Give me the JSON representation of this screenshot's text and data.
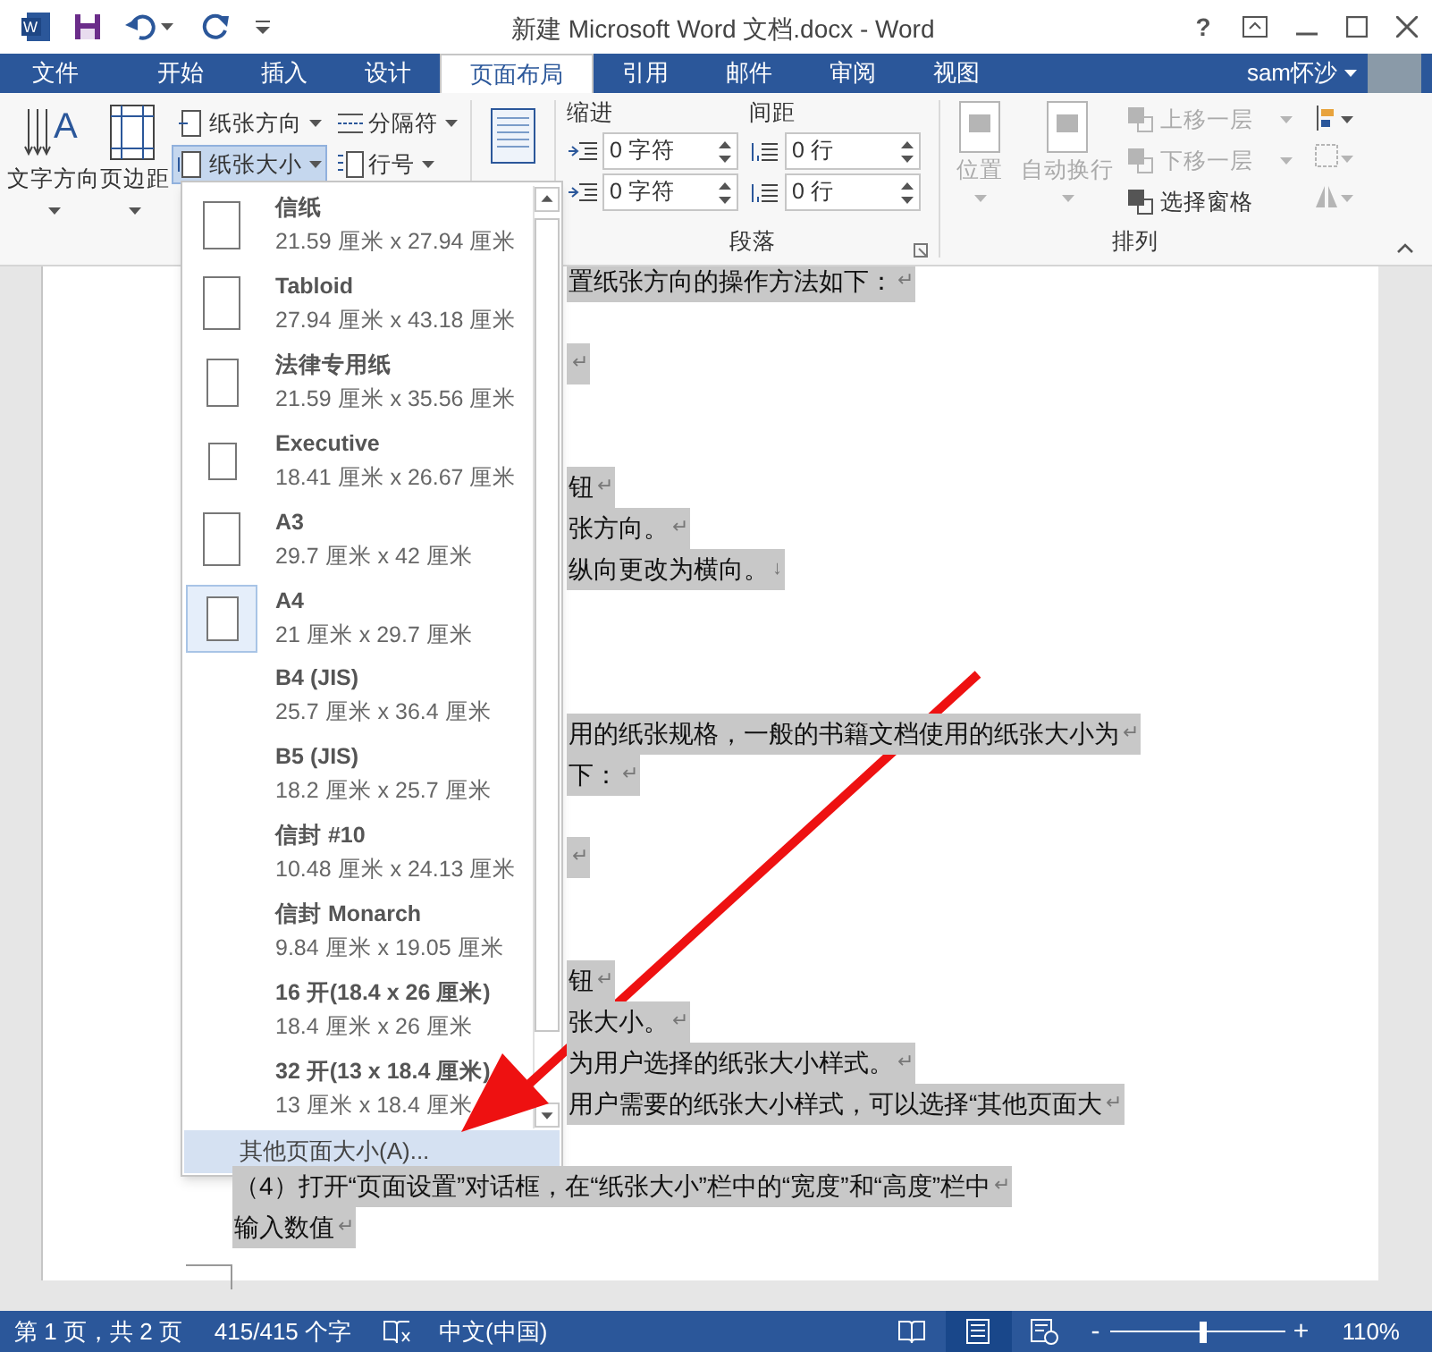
{
  "window": {
    "logo": "W",
    "title": "新建 Microsoft Word 文档.docx - Word",
    "help": "?",
    "user": "sam怀沙"
  },
  "tabs": [
    {
      "label": "文件",
      "kind": "file",
      "selected": false
    },
    {
      "label": "开始",
      "kind": "tab",
      "selected": false
    },
    {
      "label": "插入",
      "kind": "tab",
      "selected": false
    },
    {
      "label": "设计",
      "kind": "tab",
      "selected": false
    },
    {
      "label": "页面布局",
      "kind": "tab",
      "selected": true
    },
    {
      "label": "引用",
      "kind": "tab",
      "selected": false
    },
    {
      "label": "邮件",
      "kind": "tab",
      "selected": false
    },
    {
      "label": "审阅",
      "kind": "tab",
      "selected": false
    },
    {
      "label": "视图",
      "kind": "tab",
      "selected": false
    }
  ],
  "page_setup": {
    "text_direction_glyph": "A",
    "large_buttons": [
      "文字方向",
      "页边距"
    ],
    "small_buttons": [
      {
        "label": "纸张方向",
        "active": false
      },
      {
        "label": "纸张大小",
        "active": true
      },
      {
        "label": "分隔符",
        "active": false
      },
      {
        "label": "行号",
        "active": false
      }
    ]
  },
  "paragraph": {
    "label": "段落",
    "indent_label": "缩进",
    "spacing_label": "间距",
    "indent": [
      "0 字符",
      "0 字符"
    ],
    "spacing": [
      "0 行",
      "0 行"
    ]
  },
  "arrange": {
    "label": "排列",
    "large_buttons": [
      {
        "label": "位置",
        "disabled": true
      },
      {
        "label": "自动换行",
        "disabled": true
      }
    ],
    "small_buttons": [
      {
        "label": "上移一层",
        "disabled": true
      },
      {
        "label": "下移一层",
        "disabled": true
      },
      {
        "label": "选择窗格",
        "disabled": false
      }
    ]
  },
  "paper_menu": {
    "items": [
      {
        "name": "信纸",
        "size": "21.59 厘米 x 27.94 厘米",
        "kind": "icon",
        "selected": false
      },
      {
        "name": "Tabloid",
        "size": "27.94 厘米 x 43.18 厘米",
        "kind": "icon",
        "selected": false
      },
      {
        "name": "法律专用纸",
        "size": "21.59 厘米 x 35.56 厘米",
        "kind": "icon",
        "selected": false
      },
      {
        "name": "Executive",
        "size": "18.41 厘米 x 26.67 厘米",
        "kind": "icon",
        "selected": false
      },
      {
        "name": "A3",
        "size": "29.7 厘米 x 42 厘米",
        "kind": "icon",
        "selected": false
      },
      {
        "name": "A4",
        "size": "21 厘米 x 29.7 厘米",
        "kind": "icon",
        "selected": true
      },
      {
        "name": "B4 (JIS)",
        "size": "25.7 厘米 x 36.4 厘米",
        "kind": "text",
        "selected": false
      },
      {
        "name": "B5 (JIS)",
        "size": "18.2 厘米 x 25.7 厘米",
        "kind": "text",
        "selected": false
      },
      {
        "name": "信封 #10",
        "size": "10.48 厘米 x 24.13 厘米",
        "kind": "text",
        "selected": false
      },
      {
        "name": "信封 Monarch",
        "size": "9.84 厘米 x 19.05 厘米",
        "kind": "text",
        "selected": false
      },
      {
        "name": "16 开(18.4 x 26 厘米)",
        "size": "18.4 厘米 x 26 厘米",
        "kind": "text",
        "selected": false
      },
      {
        "name": "32 开(13 x 18.4 厘米)",
        "size": "13 厘米 x 18.4 厘米",
        "kind": "text",
        "selected": false
      }
    ],
    "more": "其他页面大小(A)..."
  },
  "document": {
    "lines": [
      {
        "text": "置纸张方向的操作方法如下：",
        "mark": "↵"
      },
      {
        "mark": "↵"
      },
      {
        "text": "钮",
        "mark": "↵"
      },
      {
        "text": "张方向。",
        "mark": "↵"
      },
      {
        "text": "纵向更改为横向。",
        "mark": "↓"
      },
      {
        "text": "用的纸张规格，一般的书籍文档使用的纸张大小为",
        "mark": "↵"
      },
      {
        "text": "下：",
        "mark": "↵"
      },
      {
        "mark": "↵"
      },
      {
        "text": "钮",
        "mark": "↵"
      },
      {
        "text": "张大小。",
        "mark": "↵"
      },
      {
        "text": "为用户选择的纸张大小样式。",
        "mark": "↵"
      },
      {
        "text": "用户需要的纸张大小样式，可以选择“其他页面大",
        "mark": "↵"
      },
      {
        "text": "（4）打开“页面设置”对话框，在“纸张大小”栏中的“宽度”和“高度”栏中",
        "mark": "↵"
      },
      {
        "text": "输入数值",
        "mark": "↵"
      }
    ]
  },
  "status_bar": {
    "page": "第 1 页，共 2 页",
    "words": "415/415 个字",
    "language": "中文(中国)",
    "zoom_out": "-",
    "zoom_level": {
      "level": 0.53
    },
    "zoom_in": "+",
    "zoom": "110%",
    "views": [
      {
        "selected": false
      },
      {
        "selected": true
      },
      {
        "selected": false
      }
    ]
  }
}
